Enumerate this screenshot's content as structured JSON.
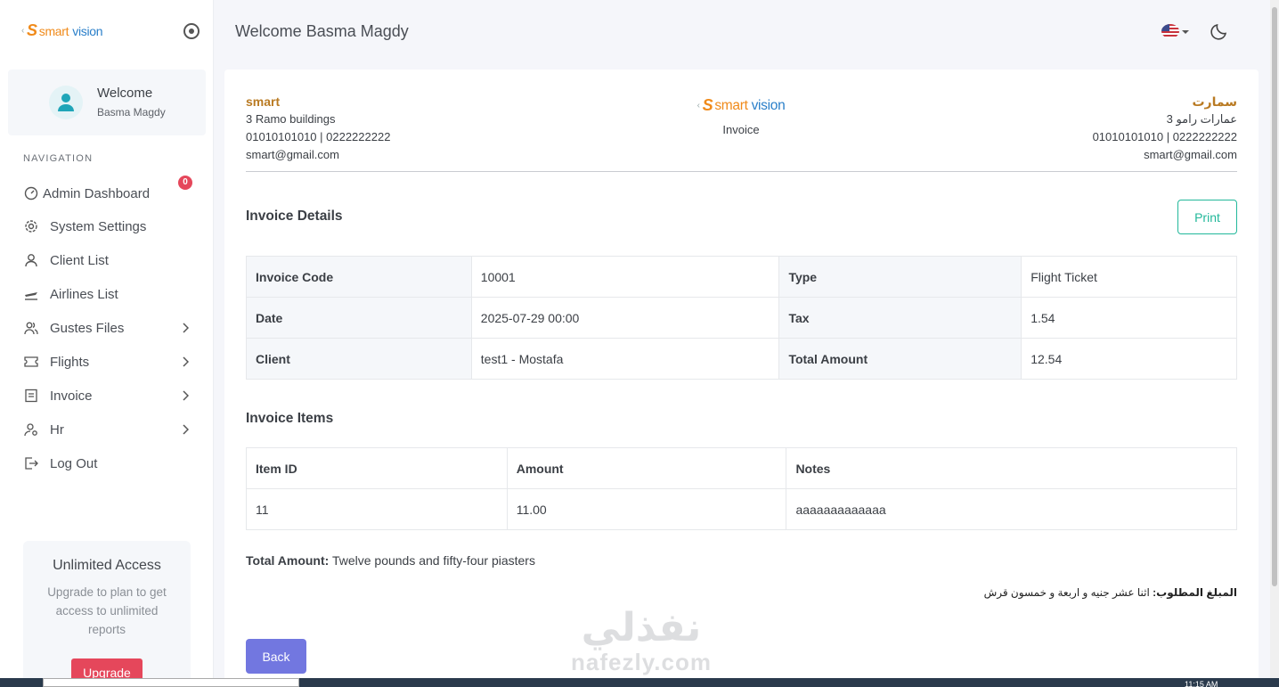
{
  "brand": {
    "word1": "smart",
    "word2": "vision",
    "accent_orange": "#f08a1a",
    "accent_blue": "#2a7fc9"
  },
  "sidebar": {
    "welcome": "Welcome",
    "user_name": "Basma Magdy",
    "nav_heading": "NAVIGATION",
    "items": [
      {
        "label": "Admin Dashboard",
        "icon": "dashboard-icon",
        "badge": "0"
      },
      {
        "label": "System Settings",
        "icon": "gear-icon"
      },
      {
        "label": "Client List",
        "icon": "user-icon"
      },
      {
        "label": "Airlines List",
        "icon": "plane-icon"
      },
      {
        "label": "Gustes Files",
        "icon": "users-icon",
        "has_submenu": true
      },
      {
        "label": "Flights",
        "icon": "ticket-icon",
        "has_submenu": true
      },
      {
        "label": "Invoice",
        "icon": "invoice-icon",
        "has_submenu": true
      },
      {
        "label": "Hr",
        "icon": "hr-icon",
        "has_submenu": true
      },
      {
        "label": "Log Out",
        "icon": "logout-icon"
      }
    ],
    "upgrade": {
      "title": "Unlimited Access",
      "description": "Upgrade to plan to get access to unlimited reports",
      "button": "Upgrade"
    }
  },
  "topbar": {
    "title": "Welcome Basma Magdy",
    "language_flag": "us-flag-icon",
    "theme_icon": "moon-icon"
  },
  "invoice": {
    "company_left": {
      "name": "smart",
      "address": "3 Ramo buildings",
      "phones": "01010101010 | 0222222222",
      "email": "smart@gmail.com"
    },
    "company_right": {
      "name": "سمارت",
      "address": "عمارات رامو 3",
      "phones": "01010101010 | 0222222222",
      "email": "smart@gmail.com"
    },
    "center_label": "Invoice",
    "details_title": "Invoice Details",
    "print_label": "Print",
    "details": [
      [
        "Invoice Code",
        "10001",
        "Type",
        "Flight Ticket"
      ],
      [
        "Date",
        "2025-07-29 00:00",
        "Tax",
        "1.54"
      ],
      [
        "Client",
        "test1 - Mostafa",
        "Total Amount",
        "12.54"
      ]
    ],
    "items_title": "Invoice Items",
    "items_headers": [
      "Item ID",
      "Amount",
      "Notes"
    ],
    "items": [
      [
        "11",
        "11.00",
        "aaaaaaaaaaaaa"
      ]
    ],
    "total_label": "Total Amount:",
    "total_words": "Twelve pounds and fifty-four piasters",
    "arabic_label": "المبلغ المطلوب:",
    "arabic_words": "اثنا عشر جنيه و اربعة و خمسون قرش",
    "back_label": "Back"
  },
  "watermark": {
    "arabic": "نفذلي",
    "latin": "nafezly.com"
  },
  "taskbar": {
    "clock": "11:15 AM"
  }
}
